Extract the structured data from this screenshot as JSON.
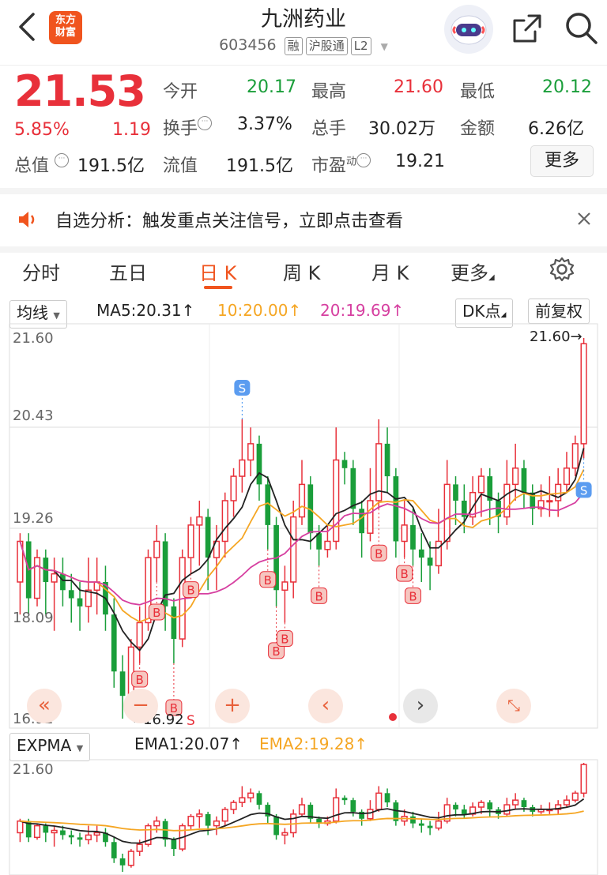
{
  "header": {
    "logo_text": "东方\n财富",
    "title": "九洲药业",
    "code": "603456",
    "tags": [
      "融",
      "沪股通",
      "L2"
    ]
  },
  "quote": {
    "price": "21.53",
    "change_pct": "5.85%",
    "change": "1.19",
    "open_label": "今开",
    "open": "20.17",
    "high_label": "最高",
    "high": "21.60",
    "low_label": "最低",
    "low": "20.12",
    "turnover_label": "换手",
    "turnover": "3.37%",
    "volume_label": "总手",
    "volume": "30.02万",
    "amount_label": "金额",
    "amount": "6.26亿",
    "mktcap_label": "总值",
    "mktcap": "191.5亿",
    "float_label": "流值",
    "float_cap": "191.5亿",
    "pe_label": "市盈",
    "pe_sup": "动",
    "pe": "19.21",
    "more_label": "更多"
  },
  "notice": {
    "text": "自选分析：触发重点关注信号，立即点击查看"
  },
  "tabs": [
    "分时",
    "五日",
    "日 K",
    "周 K",
    "月 K",
    "更多"
  ],
  "active_tab": "日 K",
  "main_chart": {
    "indicator_select": "均线",
    "ma5": "MA5:20.31",
    "ma10": "10:20.00",
    "ma20": "20:19.69",
    "dk_label": "DK点",
    "adjust_label": "前复权",
    "y_labels": [
      "21.60",
      "20.43",
      "19.26",
      "18.09",
      "16.92"
    ],
    "max_label": "21.60",
    "min_label": "16.92"
  },
  "sub_chart": {
    "indicator_select": "EXPMA",
    "ema1": "EMA1:20.07",
    "ema2": "EMA2:19.28",
    "y_label": "21.60"
  },
  "colors": {
    "up": "#e8303a",
    "down": "#1a9e3a",
    "accent": "#f0541e",
    "ma10": "#f5a623",
    "ma20": "#d63fa0"
  },
  "chart_data": {
    "type": "candlestick",
    "ylim": [
      16.92,
      21.6
    ],
    "candles": [
      {
        "o": 18.6,
        "c": 19.1,
        "h": 19.2,
        "l": 18.2
      },
      {
        "o": 19.1,
        "c": 18.4,
        "h": 19.2,
        "l": 18.2
      },
      {
        "o": 18.4,
        "c": 18.9,
        "h": 19.0,
        "l": 18.3
      },
      {
        "o": 18.9,
        "c": 18.6,
        "h": 19.0,
        "l": 18.2
      },
      {
        "o": 18.6,
        "c": 18.7,
        "h": 18.9,
        "l": 18.0
      },
      {
        "o": 18.7,
        "c": 18.5,
        "h": 18.9,
        "l": 18.3
      },
      {
        "o": 18.5,
        "c": 18.4,
        "h": 18.7,
        "l": 18.1
      },
      {
        "o": 18.4,
        "c": 18.3,
        "h": 18.6,
        "l": 18.0
      },
      {
        "o": 18.3,
        "c": 18.5,
        "h": 18.9,
        "l": 18.1
      },
      {
        "o": 18.5,
        "c": 18.6,
        "h": 18.9,
        "l": 18.2
      },
      {
        "o": 18.6,
        "c": 18.2,
        "h": 18.8,
        "l": 18.0
      },
      {
        "o": 18.2,
        "c": 17.5,
        "h": 18.4,
        "l": 17.3
      },
      {
        "o": 17.5,
        "c": 17.2,
        "h": 17.7,
        "l": 16.92
      },
      {
        "o": 17.2,
        "c": 17.8,
        "h": 17.9,
        "l": 17.1
      },
      {
        "o": 17.8,
        "c": 18.1,
        "h": 18.3,
        "l": 17.6
      },
      {
        "o": 18.1,
        "c": 18.9,
        "h": 19.0,
        "l": 18.0
      },
      {
        "o": 18.9,
        "c": 19.1,
        "h": 19.3,
        "l": 18.6
      },
      {
        "o": 19.1,
        "c": 18.3,
        "h": 19.2,
        "l": 18.0
      },
      {
        "o": 18.3,
        "c": 17.9,
        "h": 18.4,
        "l": 17.6
      },
      {
        "o": 17.9,
        "c": 18.9,
        "h": 19.0,
        "l": 17.8
      },
      {
        "o": 18.9,
        "c": 19.3,
        "h": 19.4,
        "l": 18.7
      },
      {
        "o": 19.3,
        "c": 19.4,
        "h": 19.6,
        "l": 18.8
      },
      {
        "o": 19.4,
        "c": 18.9,
        "h": 19.5,
        "l": 18.5
      },
      {
        "o": 18.9,
        "c": 19.1,
        "h": 19.3,
        "l": 18.5
      },
      {
        "o": 19.1,
        "c": 19.6,
        "h": 19.7,
        "l": 18.9
      },
      {
        "o": 19.6,
        "c": 19.9,
        "h": 20.0,
        "l": 19.4
      },
      {
        "o": 19.9,
        "c": 20.1,
        "h": 20.6,
        "l": 19.7
      },
      {
        "o": 20.1,
        "c": 20.3,
        "h": 20.5,
        "l": 19.9
      },
      {
        "o": 20.3,
        "c": 19.8,
        "h": 20.4,
        "l": 19.6
      },
      {
        "o": 19.8,
        "c": 19.3,
        "h": 19.9,
        "l": 19.0
      },
      {
        "o": 19.3,
        "c": 18.5,
        "h": 19.4,
        "l": 18.3
      },
      {
        "o": 18.5,
        "c": 18.6,
        "h": 18.8,
        "l": 18.1
      },
      {
        "o": 18.6,
        "c": 19.4,
        "h": 19.6,
        "l": 18.4
      },
      {
        "o": 19.4,
        "c": 19.8,
        "h": 20.1,
        "l": 19.3
      },
      {
        "o": 19.8,
        "c": 19.2,
        "h": 19.9,
        "l": 19.0
      },
      {
        "o": 19.2,
        "c": 19.0,
        "h": 19.3,
        "l": 18.8
      },
      {
        "o": 19.0,
        "c": 19.1,
        "h": 19.3,
        "l": 18.9
      },
      {
        "o": 19.1,
        "c": 20.1,
        "h": 20.5,
        "l": 19.0
      },
      {
        "o": 20.1,
        "c": 20.0,
        "h": 20.2,
        "l": 19.8
      },
      {
        "o": 20.0,
        "c": 19.5,
        "h": 20.1,
        "l": 19.3
      },
      {
        "o": 19.5,
        "c": 19.2,
        "h": 19.6,
        "l": 18.9
      },
      {
        "o": 19.2,
        "c": 19.6,
        "h": 20.0,
        "l": 19.1
      },
      {
        "o": 19.6,
        "c": 20.3,
        "h": 20.6,
        "l": 19.5
      },
      {
        "o": 20.3,
        "c": 19.9,
        "h": 20.5,
        "l": 19.7
      },
      {
        "o": 19.9,
        "c": 19.1,
        "h": 20.0,
        "l": 18.9
      },
      {
        "o": 19.1,
        "c": 19.3,
        "h": 19.6,
        "l": 18.9
      },
      {
        "o": 19.3,
        "c": 19.0,
        "h": 19.5,
        "l": 18.8
      },
      {
        "o": 19.0,
        "c": 18.9,
        "h": 19.2,
        "l": 18.6
      },
      {
        "o": 18.9,
        "c": 18.8,
        "h": 19.1,
        "l": 18.5
      },
      {
        "o": 18.8,
        "c": 19.1,
        "h": 19.5,
        "l": 18.7
      },
      {
        "o": 19.1,
        "c": 19.8,
        "h": 20.1,
        "l": 19.0
      },
      {
        "o": 19.8,
        "c": 19.6,
        "h": 19.9,
        "l": 19.3
      },
      {
        "o": 19.6,
        "c": 19.4,
        "h": 19.8,
        "l": 19.2
      },
      {
        "o": 19.4,
        "c": 19.7,
        "h": 19.9,
        "l": 19.3
      },
      {
        "o": 19.7,
        "c": 19.9,
        "h": 20.0,
        "l": 19.4
      },
      {
        "o": 19.9,
        "c": 19.6,
        "h": 20.0,
        "l": 19.3
      },
      {
        "o": 19.6,
        "c": 19.4,
        "h": 19.7,
        "l": 19.2
      },
      {
        "o": 19.4,
        "c": 19.8,
        "h": 20.1,
        "l": 19.3
      },
      {
        "o": 19.8,
        "c": 20.0,
        "h": 20.3,
        "l": 19.6
      },
      {
        "o": 20.0,
        "c": 19.7,
        "h": 20.1,
        "l": 19.5
      },
      {
        "o": 19.7,
        "c": 19.5,
        "h": 19.8,
        "l": 19.3
      },
      {
        "o": 19.5,
        "c": 19.6,
        "h": 19.8,
        "l": 19.4
      },
      {
        "o": 19.6,
        "c": 19.6,
        "h": 19.9,
        "l": 19.4
      },
      {
        "o": 19.6,
        "c": 19.8,
        "h": 20.0,
        "l": 19.4
      },
      {
        "o": 19.8,
        "c": 20.0,
        "h": 20.2,
        "l": 19.7
      },
      {
        "o": 20.0,
        "c": 20.3,
        "h": 20.4,
        "l": 19.9
      },
      {
        "o": 20.3,
        "c": 21.53,
        "h": 21.6,
        "l": 20.12
      }
    ],
    "buy_points": [
      14,
      16,
      18,
      20,
      29,
      30,
      31,
      35,
      42,
      45,
      46
    ],
    "sell_points": [
      26,
      66
    ]
  }
}
